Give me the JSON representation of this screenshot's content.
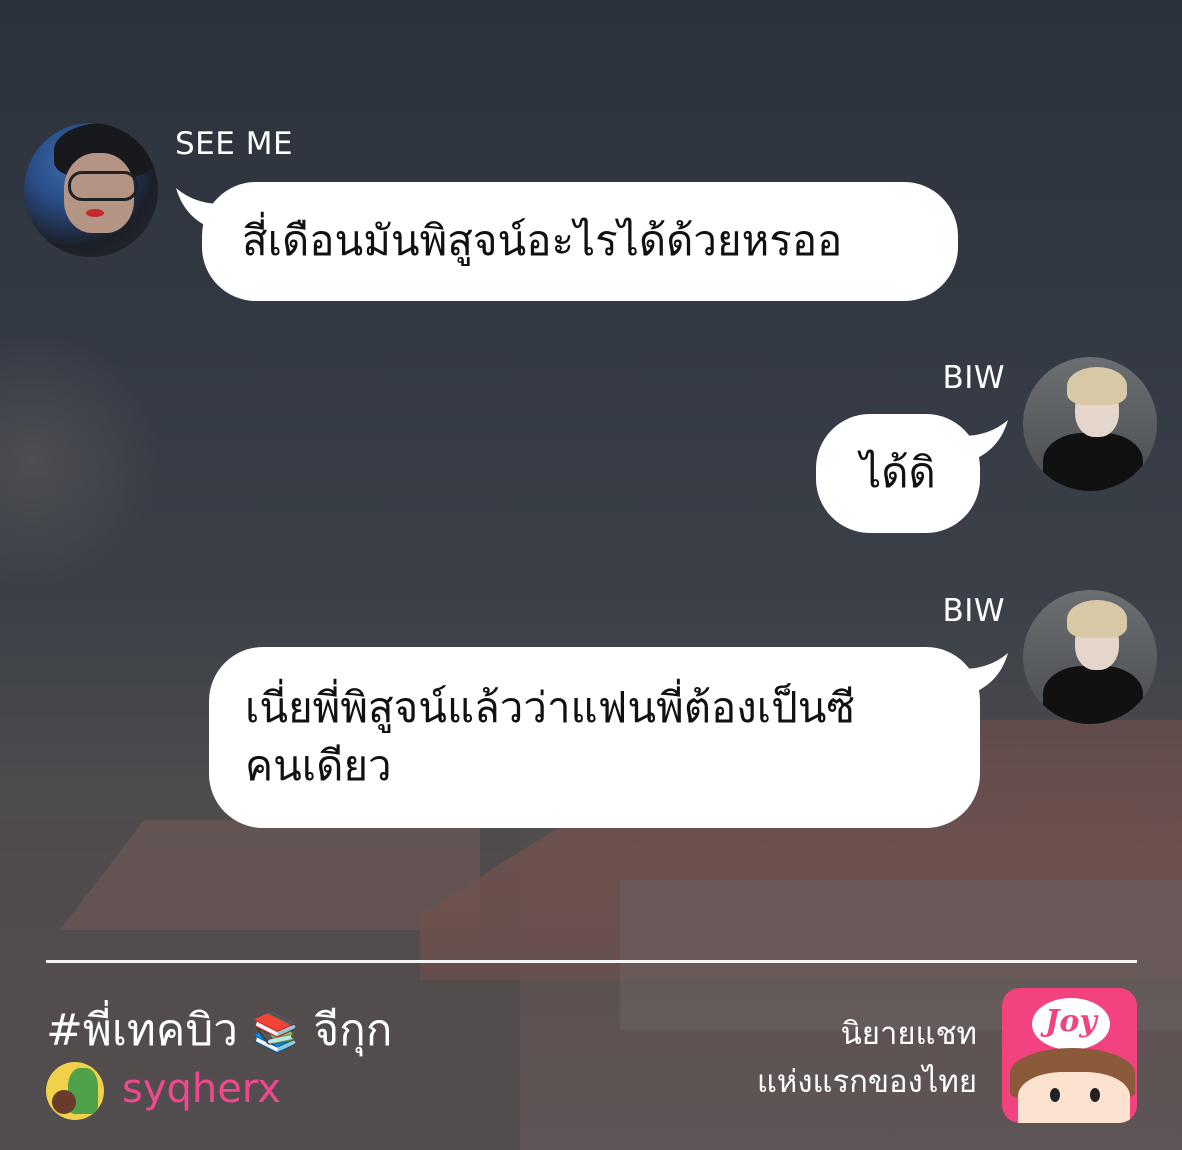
{
  "messages": [
    {
      "sender": "SEE ME",
      "side": "left",
      "text": "สี่เดือนมันพิสูจน์อะไรได้ด้วยหรออ"
    },
    {
      "sender": "BIW",
      "side": "right",
      "text": "ได้ดิ"
    },
    {
      "sender": "BIW",
      "side": "right",
      "text_line1": "เนี่ยพี่พิสูจน์แล้วว่าแฟนพี่ต้องเป็นซี",
      "text_line2": "คนเดียว"
    }
  ],
  "footer": {
    "hashtag": "#พี่เทคบิว",
    "books_emoji": "📚",
    "hashtag_suffix": "จีกุก",
    "author": "syqherx",
    "tagline_line1": "นิยายแชท",
    "tagline_line2": "แห่งแรกของไทย",
    "logo_text": "Joy",
    "logo_color": "#f2427f",
    "author_color": "#f0488e"
  }
}
